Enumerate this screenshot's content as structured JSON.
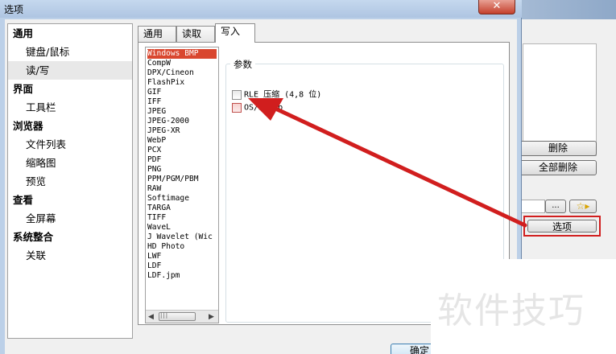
{
  "window": {
    "title": "选项",
    "close": "✕"
  },
  "nav": {
    "items": [
      {
        "label": "通用",
        "kind": "cat"
      },
      {
        "label": "键盘/鼠标",
        "kind": "sub"
      },
      {
        "label": "读/写",
        "kind": "sub",
        "selected": true
      },
      {
        "label": "界面",
        "kind": "cat"
      },
      {
        "label": "工具栏",
        "kind": "sub"
      },
      {
        "label": "浏览器",
        "kind": "cat"
      },
      {
        "label": "文件列表",
        "kind": "sub"
      },
      {
        "label": "缩略图",
        "kind": "sub"
      },
      {
        "label": "预览",
        "kind": "sub"
      },
      {
        "label": "查看",
        "kind": "cat"
      },
      {
        "label": "全屏幕",
        "kind": "sub"
      },
      {
        "label": "系统整合",
        "kind": "cat"
      },
      {
        "label": "关联",
        "kind": "sub"
      }
    ]
  },
  "tabs": [
    {
      "label": "通用"
    },
    {
      "label": "读取"
    },
    {
      "label": "写入",
      "active": true
    }
  ],
  "formats": [
    "Windows BMP",
    "CompW",
    "DPX/Cineon",
    "FlashPix",
    "GIF",
    "IFF",
    "JPEG",
    "JPEG-2000",
    "JPEG-XR",
    "WebP",
    "PCX",
    "PDF",
    "PNG",
    "PPM/PGM/PBM",
    "RAW",
    "Softimage",
    "TARGA",
    "TIFF",
    "WaveL",
    "J Wavelet (Wic",
    "HD Photo",
    "LWF",
    "LDF",
    "LDF.jpm"
  ],
  "selected_format": "Windows BMP",
  "params": {
    "group_label": "参数",
    "options": [
      {
        "label": "RLE 压缩 (4,8 位)",
        "checked": false
      },
      {
        "label": "OS/2 bmp",
        "checked": false,
        "highlight": true
      }
    ]
  },
  "buttons": {
    "ok": "确定"
  },
  "background_panel": {
    "delete": "删除",
    "delete_all": "全部删除",
    "browse": "...",
    "options": "选项"
  },
  "watermark": "软件技巧",
  "colors": {
    "annotation_red": "#d11e1e",
    "selection_red": "#d9472f"
  }
}
